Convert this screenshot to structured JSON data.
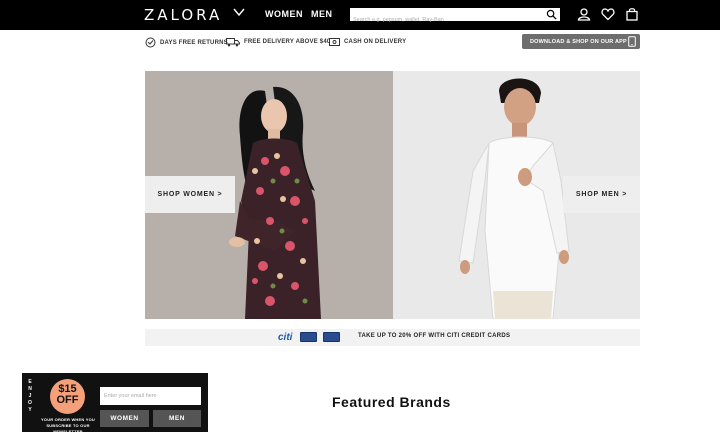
{
  "header": {
    "logo": "ZALORA",
    "nav": [
      "WOMEN",
      "MEN"
    ],
    "search_placeholder": "Search e.g. pepsum, wallet, Ray-Ban",
    "icons": [
      "user-icon",
      "heart-icon",
      "bag-icon"
    ]
  },
  "usp_bar": {
    "returns": "DAYS FREE RETURNS",
    "delivery": "FREE DELIVERY ABOVE $40",
    "cod": "CASH ON DELIVERY",
    "app_button": "DOWNLOAD & SHOP ON OUR APP"
  },
  "hero": {
    "women_button": "SHOP WOMEN >",
    "men_button": "SHOP MEN >"
  },
  "promo": {
    "logo": "citi",
    "text": "TAKE UP TO 20% OFF WITH CITI CREDIT CARDS"
  },
  "featured": {
    "title": "Featured Brands"
  },
  "newsletter": {
    "enjoy": "ENJOY",
    "amount": "$15",
    "off": "OFF",
    "subtext": "YOUR ORDER WHEN YOU SUBSCRIBE TO OUR NEWSLETTER",
    "email_placeholder": "Enter your email here",
    "women_button": "WOMEN",
    "men_button": "MEN"
  },
  "colors": {
    "header_bg": "#000000",
    "accent_orange": "#f4a07a",
    "app_button_bg": "#6d6d6d",
    "citi_blue": "#1a5ca8"
  }
}
